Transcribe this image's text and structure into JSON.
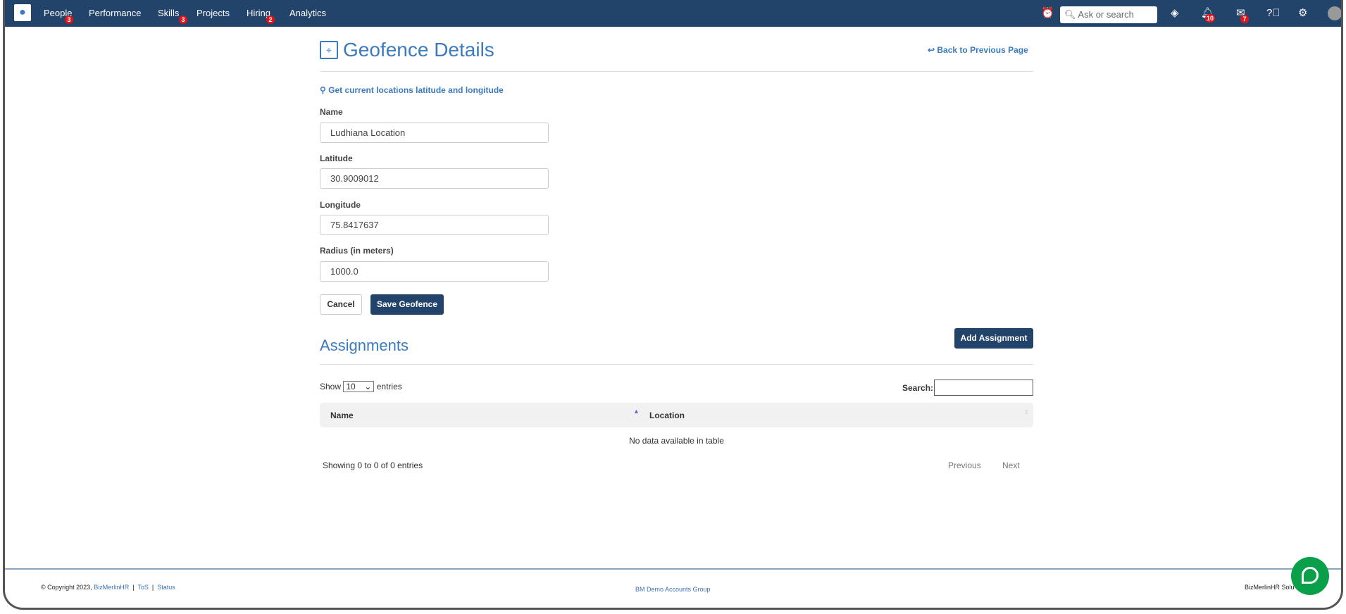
{
  "nav": {
    "items": [
      {
        "label": "People",
        "badge": "3"
      },
      {
        "label": "Performance"
      },
      {
        "label": "Skills",
        "badge": "3"
      },
      {
        "label": "Projects"
      },
      {
        "label": "Hiring",
        "badge": "2"
      },
      {
        "label": "Analytics"
      }
    ],
    "search_placeholder": "Ask or search",
    "notifications_badge": "10",
    "messages_badge": "7"
  },
  "page": {
    "title": "Geofence Details",
    "back_link": "Back to Previous Page",
    "location_link": "Get current locations latitude and longitude"
  },
  "form": {
    "name_label": "Name",
    "name_value": "Ludhiana Location",
    "lat_label": "Latitude",
    "lat_value": "30.9009012",
    "lng_label": "Longitude",
    "lng_value": "75.8417637",
    "radius_label": "Radius (in meters)",
    "radius_value": "1000.0",
    "cancel": "Cancel",
    "save": "Save Geofence"
  },
  "assignments": {
    "title": "Assignments",
    "add_button": "Add Assignment",
    "show": "Show",
    "entries_value": "10",
    "entries": "entries",
    "search_label": "Search:",
    "columns": [
      "Name",
      "Location"
    ],
    "empty": "No data available in table",
    "info": "Showing 0 to 0 of 0 entries",
    "previous": "Previous",
    "next": "Next"
  },
  "footer": {
    "copyright": "© Copyright 2023,",
    "brand": "BizMerlinHR",
    "tos": "ToS",
    "status": "Status",
    "group": "BM Demo Accounts Group",
    "right": "BizMerlinHR Solu"
  }
}
